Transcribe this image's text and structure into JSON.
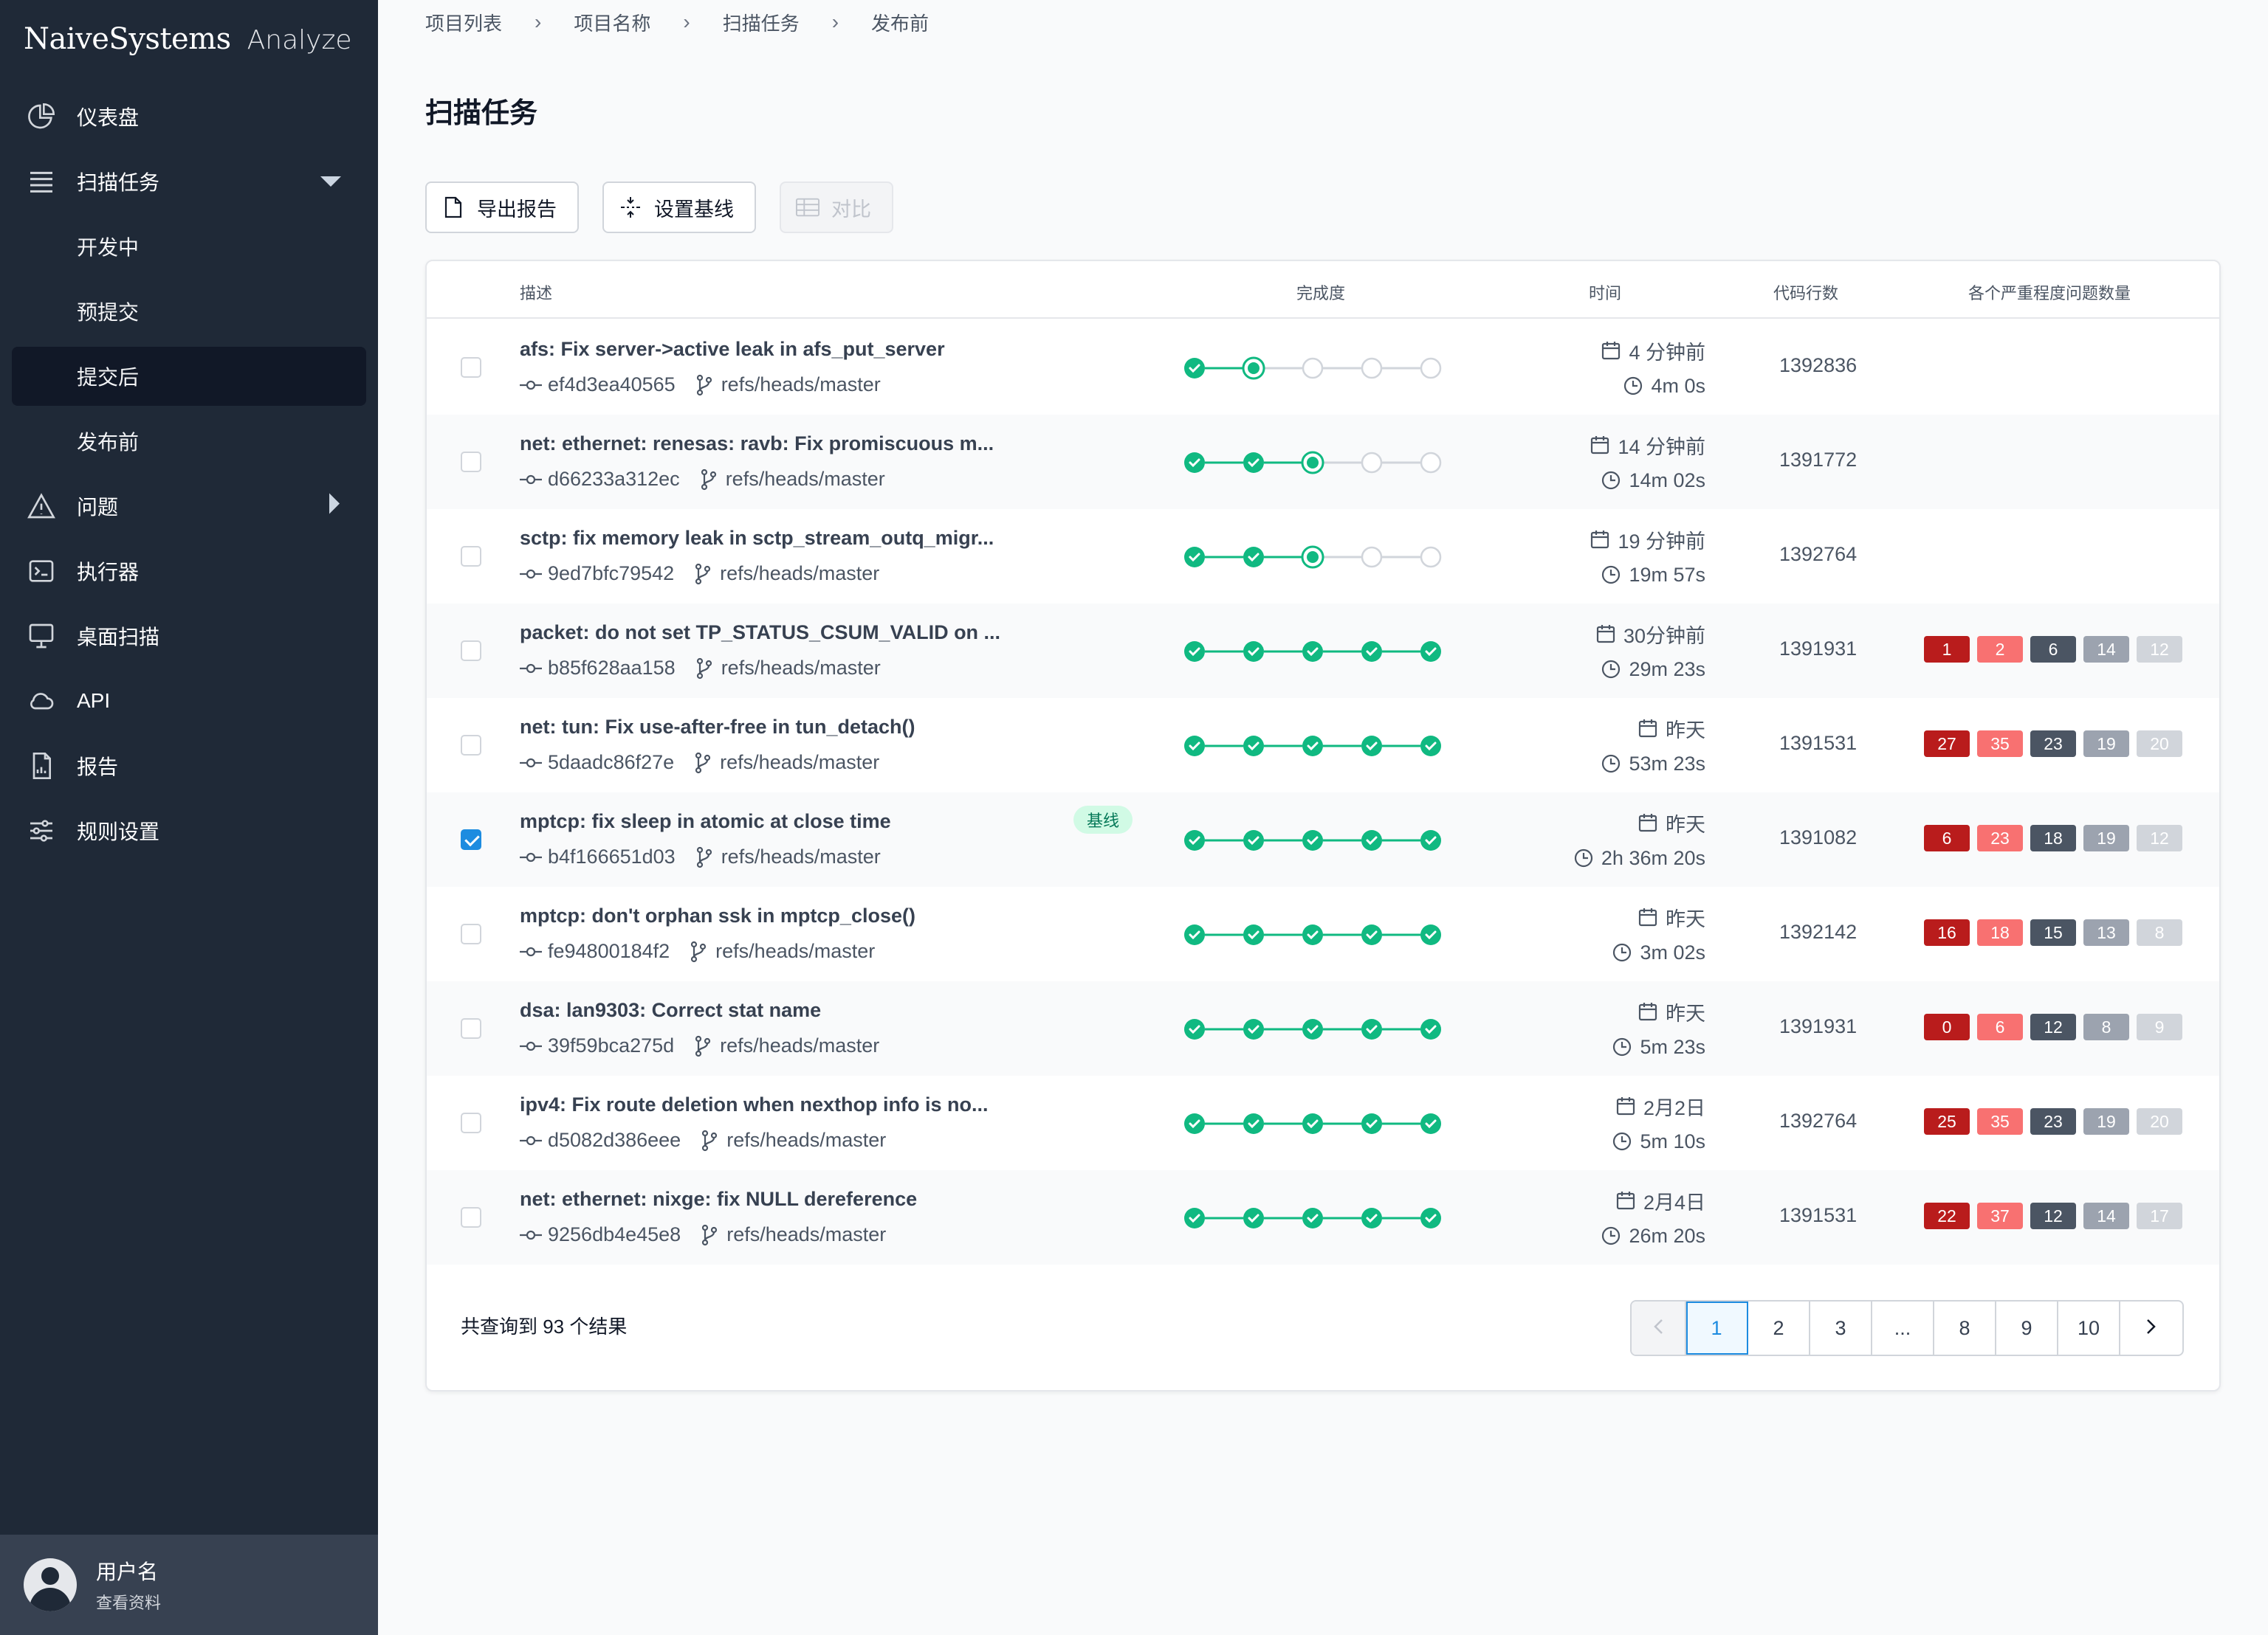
{
  "brand": {
    "name": "NaiveSystems",
    "product": "Analyze"
  },
  "sidebar": {
    "items": [
      {
        "label": "仪表盘",
        "icon": "pie-chart-icon"
      },
      {
        "label": "扫描任务",
        "icon": "list-icon",
        "expanded": true,
        "children": [
          {
            "label": "开发中"
          },
          {
            "label": "预提交"
          },
          {
            "label": "提交后",
            "active": true
          },
          {
            "label": "发布前"
          }
        ]
      },
      {
        "label": "问题",
        "icon": "warning-icon"
      },
      {
        "label": "执行器",
        "icon": "terminal-icon"
      },
      {
        "label": "桌面扫描",
        "icon": "desktop-icon"
      },
      {
        "label": "API",
        "icon": "cloud-icon"
      },
      {
        "label": "报告",
        "icon": "report-icon"
      },
      {
        "label": "规则设置",
        "icon": "sliders-icon"
      }
    ],
    "user": {
      "name": "用户名",
      "link": "查看资料"
    }
  },
  "breadcrumb": [
    "项目列表",
    "项目名称",
    "扫描任务",
    "发布前"
  ],
  "page": {
    "title": "扫描任务"
  },
  "toolbar": {
    "export": "导出报告",
    "baseline": "设置基线",
    "compare": "对比"
  },
  "table": {
    "headers": {
      "desc": "描述",
      "progress": "完成度",
      "time": "时间",
      "lines": "代码行数",
      "severity": "各个严重程度问题数量"
    },
    "rows": [
      {
        "title": "afs: Fix server->active leak in afs_put_server",
        "hash": "ef4d3ea40565",
        "ref": "refs/heads/master",
        "progress": {
          "done": 1,
          "current": 1
        },
        "date": "4 分钟前",
        "duration": "4m 0s",
        "lines": "1392836",
        "sev": [],
        "checked": false,
        "tag": ""
      },
      {
        "title": "net: ethernet: renesas: ravb: Fix promiscuous m...",
        "hash": "d66233a312ec",
        "ref": "refs/heads/master",
        "progress": {
          "done": 2,
          "current": 2
        },
        "date": "14 分钟前",
        "duration": "14m 02s",
        "lines": "1391772",
        "sev": [],
        "checked": false,
        "tag": ""
      },
      {
        "title": "sctp: fix memory leak in sctp_stream_outq_migr...",
        "hash": "9ed7bfc79542",
        "ref": "refs/heads/master",
        "progress": {
          "done": 2,
          "current": 2
        },
        "date": "19 分钟前",
        "duration": "19m 57s",
        "lines": "1392764",
        "sev": [],
        "checked": false,
        "tag": ""
      },
      {
        "title": "packet: do not set TP_STATUS_CSUM_VALID on ...",
        "hash": "b85f628aa158",
        "ref": "refs/heads/master",
        "progress": {
          "done": 5,
          "current": -1
        },
        "date": "30分钟前",
        "duration": "29m 23s",
        "lines": "1391931",
        "sev": [
          "1",
          "2",
          "6",
          "14",
          "12"
        ],
        "checked": false,
        "tag": ""
      },
      {
        "title": "net: tun: Fix use-after-free in tun_detach()",
        "hash": "5daadc86f27e",
        "ref": "refs/heads/master",
        "progress": {
          "done": 5,
          "current": -1
        },
        "date": "昨天",
        "duration": "53m 23s",
        "lines": "1391531",
        "sev": [
          "27",
          "35",
          "23",
          "19",
          "20"
        ],
        "checked": false,
        "tag": ""
      },
      {
        "title": "mptcp: fix sleep in atomic at close time",
        "hash": "b4f166651d03",
        "ref": "refs/heads/master",
        "progress": {
          "done": 5,
          "current": -1
        },
        "date": "昨天",
        "duration": "2h 36m 20s",
        "lines": "1391082",
        "sev": [
          "6",
          "23",
          "18",
          "19",
          "12"
        ],
        "checked": true,
        "tag": "基线"
      },
      {
        "title": "mptcp: don't orphan ssk in mptcp_close()",
        "hash": "fe94800184f2",
        "ref": "refs/heads/master",
        "progress": {
          "done": 5,
          "current": -1
        },
        "date": "昨天",
        "duration": "3m 02s",
        "lines": "1392142",
        "sev": [
          "16",
          "18",
          "15",
          "13",
          "8"
        ],
        "checked": false,
        "tag": ""
      },
      {
        "title": "dsa: lan9303: Correct stat name",
        "hash": "39f59bca275d",
        "ref": "refs/heads/master",
        "progress": {
          "done": 5,
          "current": -1
        },
        "date": "昨天",
        "duration": "5m 23s",
        "lines": "1391931",
        "sev": [
          "0",
          "6",
          "12",
          "8",
          "9"
        ],
        "checked": false,
        "tag": ""
      },
      {
        "title": "ipv4: Fix route deletion when nexthop info is no...",
        "hash": "d5082d386eee",
        "ref": "refs/heads/master",
        "progress": {
          "done": 5,
          "current": -1
        },
        "date": "2月2日",
        "duration": "5m 10s",
        "lines": "1392764",
        "sev": [
          "25",
          "35",
          "23",
          "19",
          "20"
        ],
        "checked": false,
        "tag": ""
      },
      {
        "title": "net: ethernet: nixge: fix NULL dereference",
        "hash": "9256db4e45e8",
        "ref": "refs/heads/master",
        "progress": {
          "done": 5,
          "current": -1
        },
        "date": "2月4日",
        "duration": "26m 20s",
        "lines": "1391531",
        "sev": [
          "22",
          "37",
          "12",
          "14",
          "17"
        ],
        "checked": false,
        "tag": ""
      }
    ]
  },
  "colors": {
    "success": "#10b981",
    "sev": [
      "#b91c1c",
      "#f87171",
      "#4b5563",
      "#9ca3af",
      "#d1d5db"
    ]
  },
  "footer": {
    "total": "共查询到 93 个结果",
    "pages": [
      "1",
      "2",
      "3",
      "...",
      "8",
      "9",
      "10"
    ],
    "current": "1"
  }
}
